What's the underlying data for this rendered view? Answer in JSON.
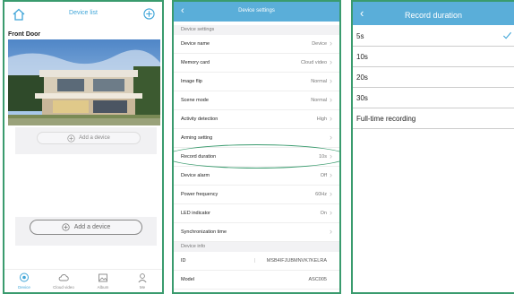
{
  "device_list": {
    "title": "Device list",
    "camera_name": "Front Door",
    "add_device_1": "Add a device",
    "add_device_2": "Add a device",
    "tabs": [
      "Device",
      "Cloud video",
      "Album",
      "Me"
    ]
  },
  "settings": {
    "title": "Device settings",
    "section_1": "Device settings",
    "section_2": "Device info",
    "rows": [
      {
        "label": "Device name",
        "value": "Device"
      },
      {
        "label": "Memory card",
        "value": "Cloud video"
      },
      {
        "label": "Image flip",
        "value": "Normal"
      },
      {
        "label": "Scene mode",
        "value": "Normal"
      },
      {
        "label": "Activity detection",
        "value": "High"
      },
      {
        "label": "Arming setting",
        "value": ""
      },
      {
        "label": "Record duration",
        "value": "10s"
      },
      {
        "label": "Device alarm",
        "value": "Off"
      },
      {
        "label": "Power frequency",
        "value": "60Hz"
      },
      {
        "label": "LED indicator",
        "value": "On"
      },
      {
        "label": "Synchronization time",
        "value": ""
      }
    ],
    "info": [
      {
        "label": "ID",
        "separator": "|",
        "value": "MSB4IFJUBMNVK7KELRA"
      },
      {
        "label": "Model",
        "value": "ASC005"
      }
    ]
  },
  "record_duration": {
    "title": "Record duration",
    "selected_index": 0,
    "options": [
      "5s",
      "10s",
      "20s",
      "30s",
      "Full-time recording"
    ]
  },
  "colors": {
    "accent": "#5aaed9",
    "frame": "#3a9b6e",
    "check": "#3fa5d8"
  }
}
